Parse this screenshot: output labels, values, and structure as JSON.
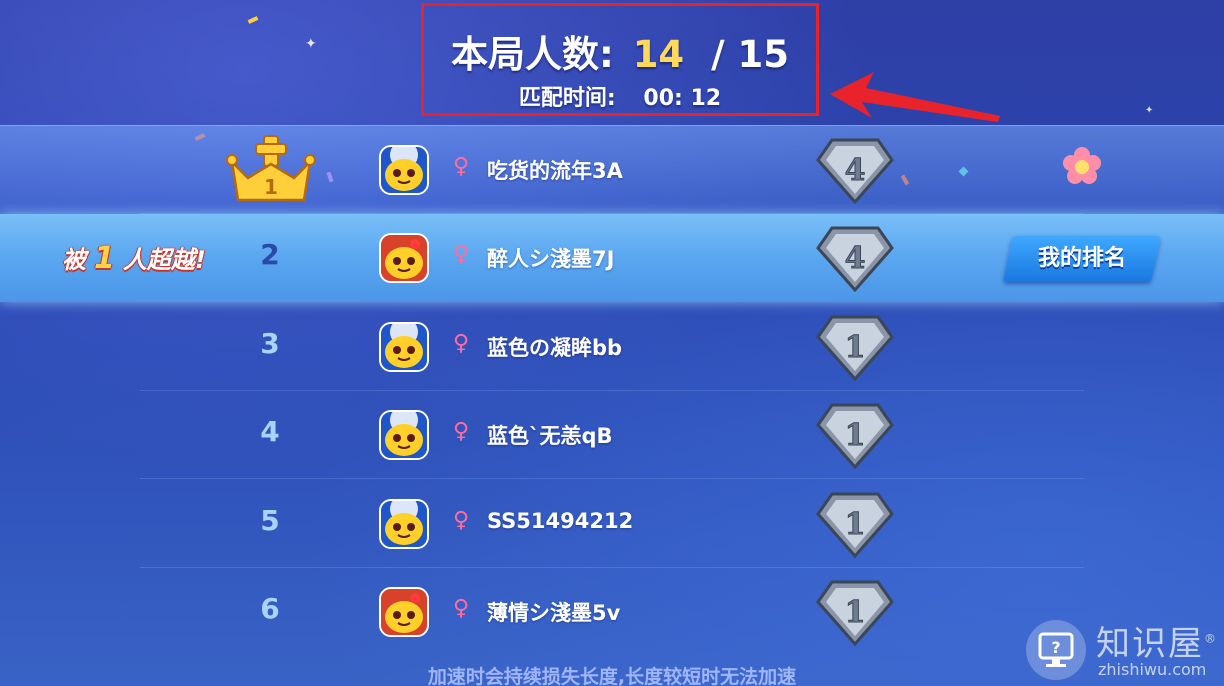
{
  "header": {
    "player_count_label": "本局人数:",
    "player_count_current": "14",
    "player_count_separator": "/",
    "player_count_total": "15",
    "match_time_label": "匹配时间:",
    "match_time_value": "00: 12"
  },
  "highlight_colors": {
    "annotation_box": "#e8232b",
    "annotation_arrow": "#e8232b",
    "current_count": "#ffd95a"
  },
  "rank_list": {
    "rows": [
      {
        "rank": "1",
        "rank_display": "crown-icon",
        "name": "吃货的流年3A",
        "gender": "♀",
        "badge_level": "4",
        "extra_icon": "flower-icon"
      },
      {
        "rank": "2",
        "name": "醉人シ淺墨7J",
        "gender": "♀",
        "badge_level": "4",
        "is_me": true
      },
      {
        "rank": "3",
        "name": "蓝色の凝眸bb",
        "gender": "♀",
        "badge_level": "1"
      },
      {
        "rank": "4",
        "name": "蓝色`无恙qB",
        "gender": "♀",
        "badge_level": "1"
      },
      {
        "rank": "5",
        "name": "SS51494212",
        "gender": "♀",
        "badge_level": "1"
      },
      {
        "rank": "6",
        "name": "薄情シ淺墨5v",
        "gender": "♀",
        "badge_level": "1"
      }
    ]
  },
  "overtaken": {
    "prefix": "被",
    "count": "1",
    "suffix": "人超越!"
  },
  "my_rank_button": {
    "label": "我的排名"
  },
  "crown_rank": "1",
  "tip": "加速时会持续损失长度,长度较短时无法加速",
  "watermark": {
    "title": "知识屋",
    "url": "zhishiwu.com",
    "mark": "®"
  }
}
